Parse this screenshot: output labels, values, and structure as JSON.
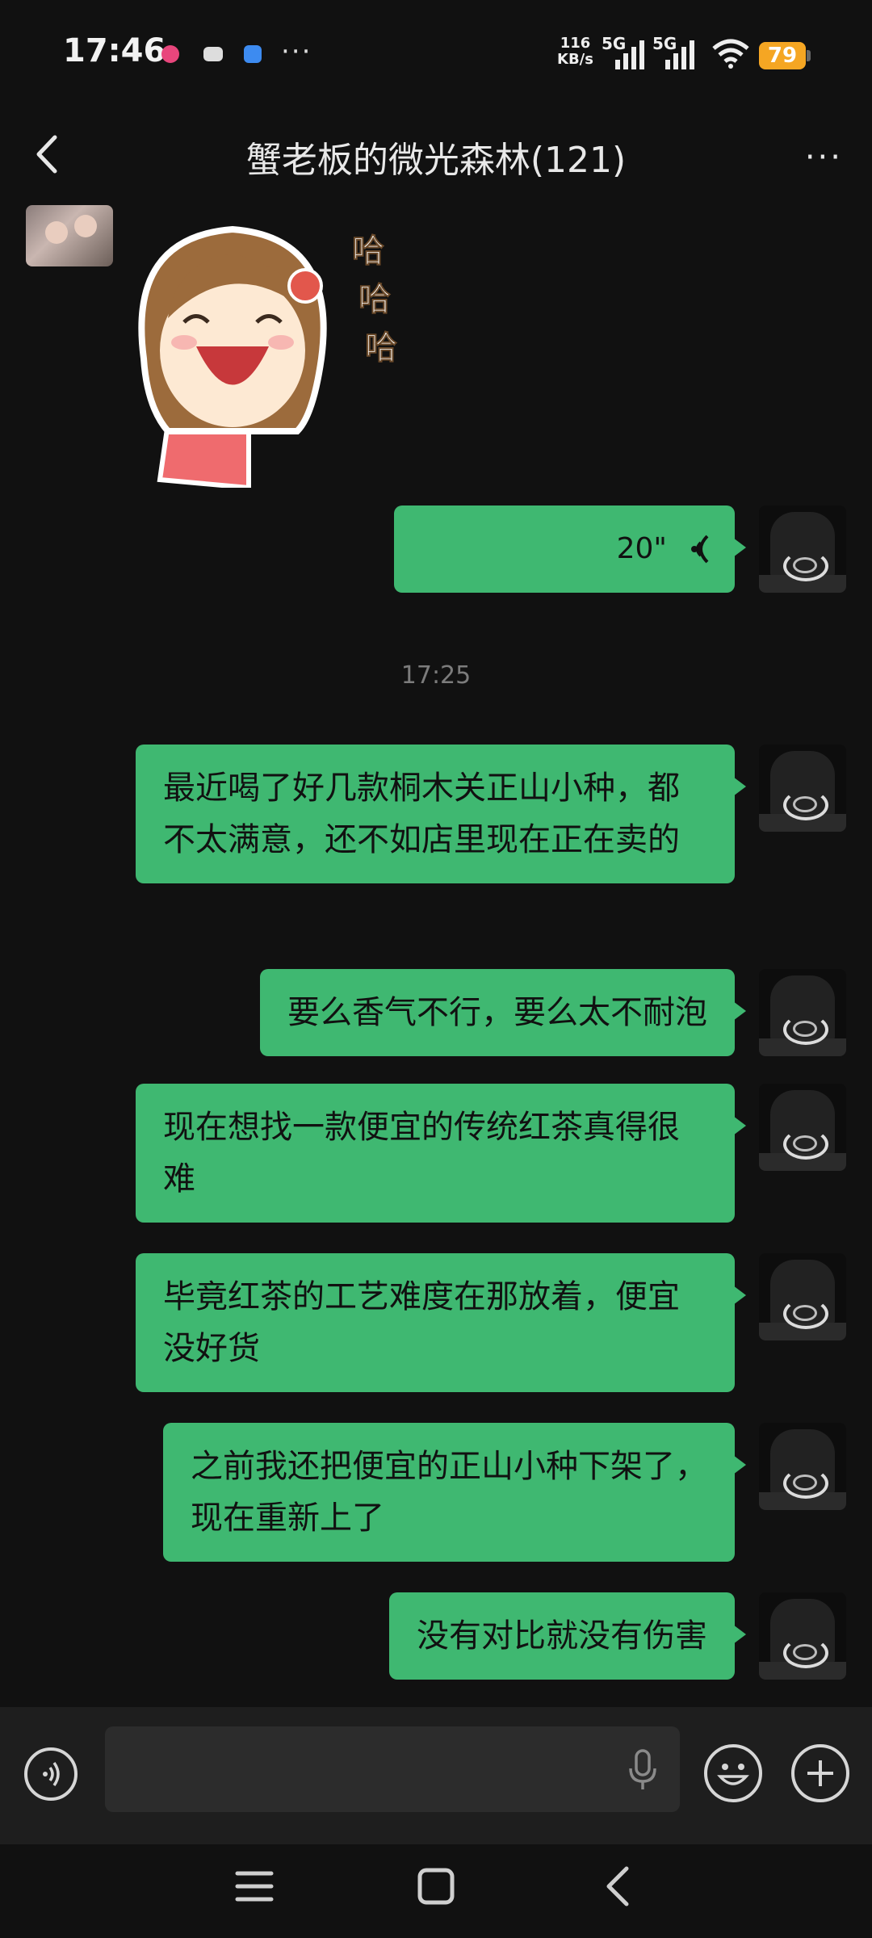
{
  "status_bar": {
    "time": "17:46",
    "net_speed_value": "116",
    "net_speed_unit": "KB/s",
    "sim1_label": "5G",
    "sim2_label": "5G",
    "battery": "79",
    "more_icons": "···"
  },
  "header": {
    "title": "蟹老板的微光森林(121)",
    "menu": "···"
  },
  "chat": {
    "sticker_text": [
      "哈",
      "哈",
      "哈"
    ],
    "voice_duration": "20\"",
    "timestamp": "17:25",
    "messages": [
      {
        "text": "最近喝了好几款桐木关正山小种，都不太满意，还不如店里现在正在卖的"
      },
      {
        "text": "要么香气不行，要么太不耐泡"
      },
      {
        "text": "现在想找一款便宜的传统红茶真得很难"
      },
      {
        "text": "毕竟红茶的工艺难度在那放着，便宜没好货"
      },
      {
        "text": "之前我还把便宜的正山小种下架了，现在重新上了"
      },
      {
        "text": "没有对比就没有伤害"
      }
    ]
  },
  "colors": {
    "bubble": "#3fb871",
    "background": "#111111",
    "battery": "#f5a623"
  },
  "icons": {
    "back": "chevron-left-icon",
    "voice_input": "voice-wave-icon",
    "mic": "microphone-icon",
    "emoji": "smiley-icon",
    "add": "plus-icon"
  }
}
